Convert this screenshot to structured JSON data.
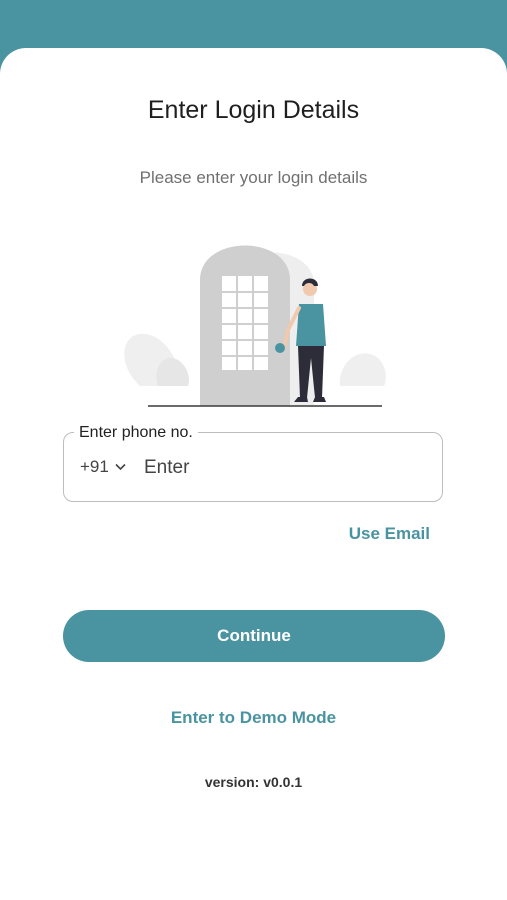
{
  "header": {
    "title": "Enter Login Details",
    "subtitle": "Please enter your login details"
  },
  "illustration": {
    "icon": "person-opening-door-illustration"
  },
  "phone": {
    "label": "Enter phone no.",
    "country_code": "+91",
    "placeholder": "Enter",
    "value": ""
  },
  "links": {
    "use_email": "Use Email",
    "demo_mode": "Enter to Demo Mode"
  },
  "actions": {
    "continue_label": "Continue"
  },
  "footer": {
    "version": "version: v0.0.1"
  },
  "colors": {
    "accent": "#4a93a1",
    "text": "#1f1f1f",
    "muted": "#707070"
  }
}
